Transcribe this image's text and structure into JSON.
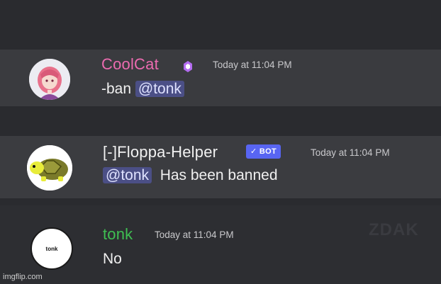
{
  "messages": [
    {
      "username": "CoolCat",
      "timestamp": "Today at 11:04 PM",
      "content_prefix": "-ban ",
      "mention": "@tonk",
      "avatar": "anime-girl-avatar",
      "badge_icon": "nitro-badge-icon",
      "username_color": "#ec6bb0"
    },
    {
      "username": "[-]Floppa-Helper",
      "bot_tag": "✓ BOT",
      "timestamp": "Today at 11:04 PM",
      "mention": "@tonk",
      "content_suffix": "Has been banned",
      "avatar": "turtle-avatar",
      "username_color": "#f1f1f1"
    },
    {
      "username": "tonk",
      "timestamp": "Today at 11:04 PM",
      "content": "No",
      "avatar_label": "tonk",
      "username_color": "#3fbf52"
    }
  ],
  "watermark": "imgflip.com",
  "ghost_text": "ZDAK",
  "colors": {
    "mention_bg": "#4b4f86",
    "bot_tag_bg": "#5865f2"
  }
}
